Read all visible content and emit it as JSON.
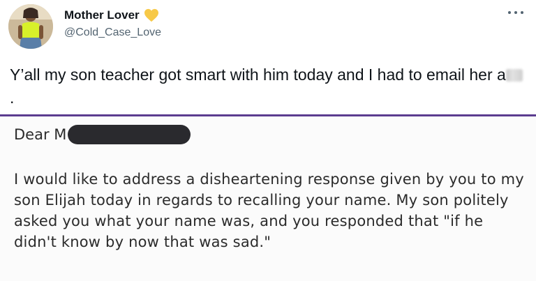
{
  "author": {
    "display_name": "Mother Lover",
    "handle": "@Cold_Case_Love",
    "badge_icon": "yellow-heart-icon",
    "badge_color": "#f7c948"
  },
  "menu": {
    "icon": "more-options-icon"
  },
  "tweet": {
    "text_before": "Y’all my son teacher got smart with him today and I had to email her a",
    "text_after": "."
  },
  "email": {
    "salutation": "Dear M",
    "body": "I would like to address a disheartening response given by you to  my son Elijah today in regards to recalling your name. My son politely asked you what your name was, and you responded that \"if he didn't know by now that was sad.\""
  },
  "colors": {
    "divider": "#5b3c8f",
    "text": "#0f1419",
    "secondary_text": "#536471",
    "redaction": "#2a2a2e"
  }
}
